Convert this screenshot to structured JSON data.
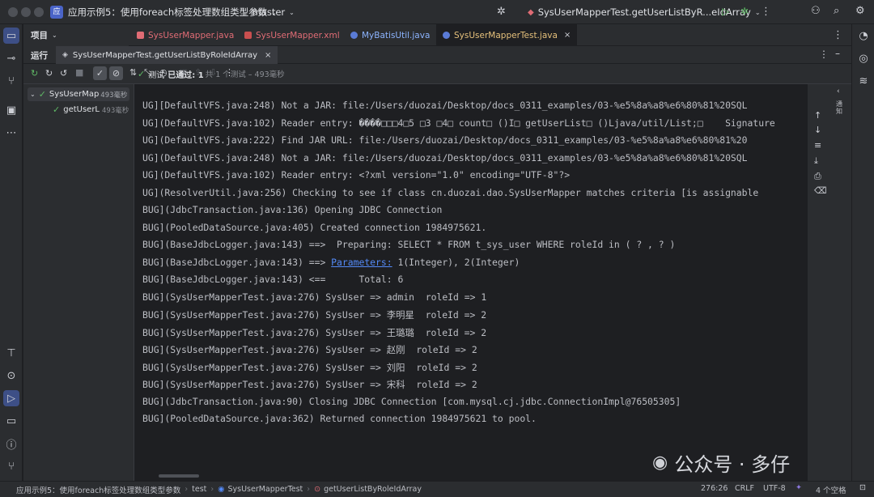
{
  "titlebar": {
    "project_badge": "应",
    "project_name": "应用示例5：使用foreach标签处理数组类型参数",
    "branch": "master",
    "run_config": "SysUserMapperTest.getUserListByR...eIdArray"
  },
  "project_panel_label": "项目",
  "tabs": [
    {
      "label": "SysUserMapper.java",
      "color": "#e06c75",
      "active": false
    },
    {
      "label": "SysUserMapper.xml",
      "color": "#e06c75",
      "active": false
    },
    {
      "label": "MyBatisUtil.java",
      "color": "#8cb4ff",
      "active": false
    },
    {
      "label": "SysUserMapperTest.java",
      "color": "#e5c07b",
      "active": true
    }
  ],
  "run": {
    "label": "运行",
    "tab_label": "SysUserMapperTest.getUserListByRoleIdArray"
  },
  "test_status": {
    "prefix": "测试",
    "passed": "已通过: 1",
    "detail": "共 1 个测试 – 493毫秒"
  },
  "tree": [
    {
      "label": "SysUserMap",
      "time": "493毫秒"
    },
    {
      "label": "getUserL",
      "time": "493毫秒"
    }
  ],
  "console_lines": [
    "UG][DefaultVFS.java:248) Not a JAR: file:/Users/duozai/Desktop/docs_0311_examples/03-%e5%8a%a8%e6%80%81%20SQL",
    "UG](DefaultVFS.java:102) Reader entry: ����□□□4□5 □3 □4□ count□ ()I□ getUserList□ ()Ljava/util/List;□    Signature",
    "UG](DefaultVFS.java:222) Find JAR URL: file:/Users/duozai/Desktop/docs_0311_examples/03-%e5%8a%a8%e6%80%81%20",
    "UG](DefaultVFS.java:248) Not a JAR: file:/Users/duozai/Desktop/docs_0311_examples/03-%e5%8a%a8%e6%80%81%20SQL",
    "UG](DefaultVFS.java:102) Reader entry: <?xml version=\"1.0\" encoding=\"UTF-8\"?>",
    "UG](ResolverUtil.java:256) Checking to see if class cn.duozai.dao.SysUserMapper matches criteria [is assignable",
    "BUG](JdbcTransaction.java:136) Opening JDBC Connection",
    "BUG](PooledDataSource.java:405) Created connection 1984975621.",
    "BUG](BaseJdbcLogger.java:143) ==>  Preparing: SELECT * FROM t_sys_user WHERE roleId in ( ? , ? )",
    "BUG](BaseJdbcLogger.java:143) ==> ",
    "BUG](BaseJdbcLogger.java:143) <==      Total: 6",
    "BUG](SysUserMapperTest.java:276) SysUser => admin  roleId => 1",
    "BUG](SysUserMapperTest.java:276) SysUser => 李明星  roleId => 2",
    "BUG](SysUserMapperTest.java:276) SysUser => 王璐璐  roleId => 2",
    "BUG](SysUserMapperTest.java:276) SysUser => 赵刚  roleId => 2",
    "BUG](SysUserMapperTest.java:276) SysUser => 刘阳  roleId => 2",
    "BUG](SysUserMapperTest.java:276) SysUser => 宋科  roleId => 2",
    "BUG](JdbcTransaction.java:90) Closing JDBC Connection [com.mysql.cj.jdbc.ConnectionImpl@76505305]",
    "BUG](PooledDataSource.java:362) Returned connection 1984975621 to pool."
  ],
  "params_link": "Parameters:",
  "params_rest": " 1(Integer), 2(Integer)",
  "watermark": "公众号 · 多仔",
  "right_panel_label": "通知",
  "statusbar": {
    "crumb_project": "应用示例5：使用foreach标签处理数组类型参数",
    "crumb_test": "test",
    "crumb_class": "SysUserMapperTest",
    "crumb_method": "getUserListByRoleIdArray",
    "position": "276:26",
    "line_ending": "CRLF",
    "encoding": "UTF-8",
    "indent": "4 个空格"
  }
}
